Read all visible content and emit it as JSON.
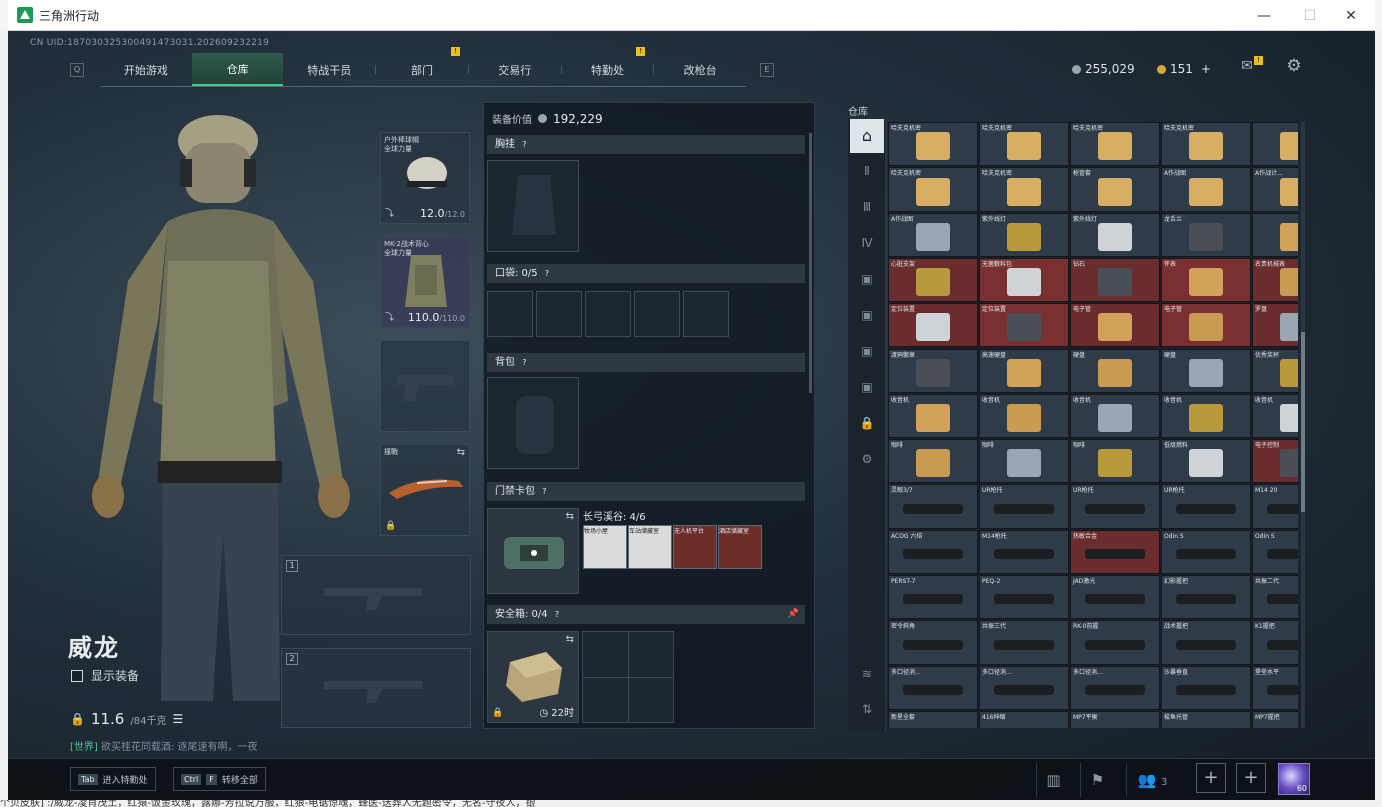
{
  "window": {
    "title": "三角洲行动",
    "minimize_icon": "—",
    "maximize_icon": "☐",
    "close_icon": "✕"
  },
  "header": {
    "uid": "CN UID:18703032530049147303​1.202609232219",
    "key_left": "Q",
    "key_right": "E",
    "tabs": [
      {
        "label": "开始游戏",
        "active": false
      },
      {
        "label": "仓库",
        "active": true
      },
      {
        "label": "特战干员",
        "active": false
      },
      {
        "label": "部门",
        "active": false,
        "badge": "!"
      },
      {
        "label": "交易行",
        "active": false
      },
      {
        "label": "特勤处",
        "active": false,
        "badge": "!"
      },
      {
        "label": "改枪台",
        "active": false
      }
    ],
    "currency_havoc": "255,029",
    "currency_coins": "151",
    "plus": "+",
    "mail_badge": "!"
  },
  "operator": {
    "name": "威龙",
    "show_equipment": "显示装备",
    "weight": "11.6",
    "weight_max": "/84千克",
    "chat_tag": "[世界]",
    "chat_text": "欲买桂花同载酒:  逐尾速有啊，一夜"
  },
  "slots": {
    "helmet": {
      "label": "户外棒球帽\n全球力量",
      "value": "12.0",
      "max": "/12.0"
    },
    "armor": {
      "label": "MK-2战术背心\n全球力量",
      "value": "110.0",
      "max": "/110.0"
    },
    "melee": {
      "label": "撞戰"
    },
    "primary1": {
      "num": "1"
    },
    "primary2": {
      "num": "2"
    }
  },
  "equipment": {
    "value_label": "装备价值",
    "value": "192,229",
    "chest_rig": "胸挂",
    "pockets": "口袋: 0/5",
    "backpack": "背包",
    "keycard": "门禁卡包",
    "keycard_capacity": "长弓溪谷: 4/6",
    "keycards": [
      {
        "label": "牧场小屋",
        "color": "#e6e6e6"
      },
      {
        "label": "车站储藏室",
        "color": "#e6e6e6"
      },
      {
        "label": "无人机平台",
        "color": "#c89a52"
      },
      {
        "label": "酒店储藏室",
        "color": "#c89a52"
      }
    ],
    "secure_case": "安全箱: 0/4",
    "secure_timer": "22时",
    "help": "?"
  },
  "stash": {
    "title": "仓库",
    "rows": [
      [
        "哈夫克机密",
        "哈夫克机密",
        "哈夫克机密",
        "哈夫克机密",
        ""
      ],
      [
        "哈夫克机密",
        "哈夫克机密",
        "枪管套",
        "A作战图",
        "A作战计..."
      ],
      [
        "A作战图",
        "紫外线灯",
        "紫外线灯",
        "龙舌兰",
        ""
      ],
      [
        "心脏支架",
        "无菌敷料包",
        "钻石",
        "怀表",
        "名贵机械表"
      ],
      [
        "定位装置",
        "定位装置",
        "电子管",
        "电子管",
        "罗盘"
      ],
      [
        "渡鸦徽章",
        "高速硬盘",
        "硬盘",
        "硬盘",
        "优秀奖杯"
      ],
      [
        "收音机",
        "收音机",
        "收音机",
        "收音机",
        "收音机"
      ],
      [
        "咖啡",
        "咖啡",
        "咖啡",
        "低级燃料",
        "电子控制"
      ],
      [
        "灵眼3/7",
        "UR枪托",
        "UR枪托",
        "UR枪托",
        "M14 20"
      ],
      [
        "ACOG 六倍",
        "M14枪托",
        "热敏合金",
        "Odin S",
        "Odin S"
      ],
      [
        "PERST-7",
        "PEQ-2",
        "JAD激光",
        "幻影握把",
        "共振二代"
      ],
      [
        "密令斜角",
        "共振三代",
        "RK-0前握",
        "战术握把",
        "K1握把"
      ],
      [
        "多口径消...",
        "多口径消...",
        "多口径消...",
        "沙暴垂直",
        "堡垒水平"
      ],
      [
        "新星全套",
        "416伸缩",
        "MP7平衡",
        "梭鱼托管",
        "MP7握把"
      ]
    ]
  },
  "bottom": {
    "tab_key": "Tab",
    "tab_label": "进入特勤处",
    "ctrl_key": "Ctrl",
    "f_key": "F",
    "ctrl_label": "转移全部",
    "squad_count": "3",
    "level": "60",
    "ticker": "个贝皮肤] :/威龙-凌肖茂土，红猿-饭金玫瑰，露娜-芳拉说万服，红狼-电锯惊魂，蜂医-送葬人无题密令，无名-守夜人，银"
  }
}
